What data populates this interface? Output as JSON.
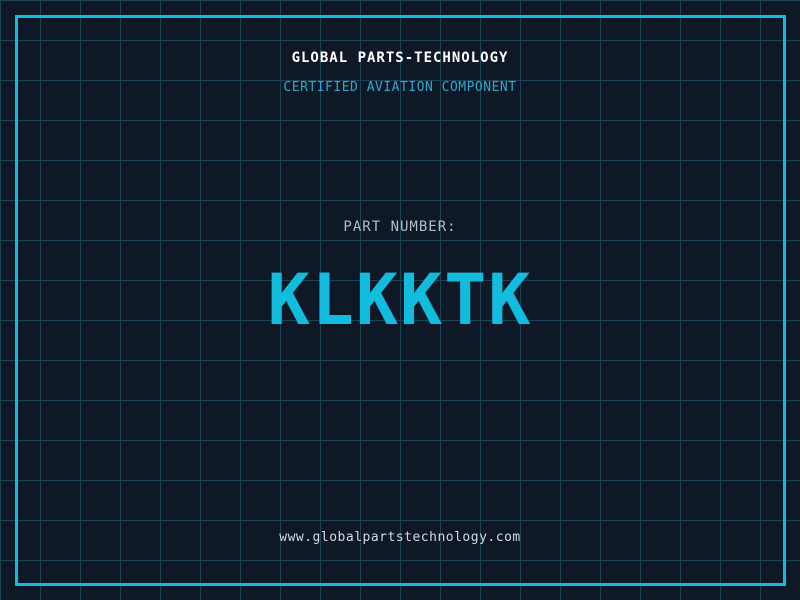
{
  "brand": {
    "title": "GLOBAL PARTS-TECHNOLOGY",
    "subtitle": "CERTIFIED AVIATION COMPONENT"
  },
  "part": {
    "label": "PART NUMBER:",
    "number": "KLKKTK"
  },
  "footer": {
    "website": "www.globalpartstechnology.com"
  },
  "colors": {
    "background": "#0f1826",
    "grid_line": "#1b4557",
    "accent": "#12bcdc",
    "title_text": "#ffffff",
    "subtitle_text": "#2fa9cb",
    "label_text": "#aebecb",
    "url_text": "#d2dae2"
  }
}
